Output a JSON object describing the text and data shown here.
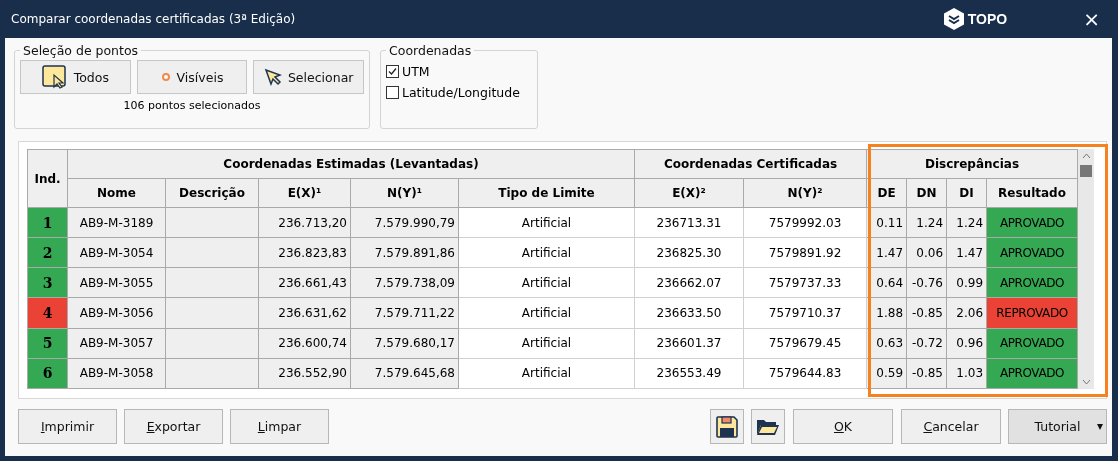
{
  "window": {
    "title": "Comparar coordenadas certificadas (3ª Edição)",
    "brand": "TOPO",
    "close": "×"
  },
  "point_selection": {
    "title": "Seleção de pontos",
    "buttons": [
      {
        "kind": "all",
        "label": "Todos"
      },
      {
        "kind": "visible",
        "label": "Visíveis"
      },
      {
        "kind": "select",
        "label": "Selecionar"
      }
    ],
    "count": "106 pontos selecionados"
  },
  "coordinates": {
    "title": "Coordenadas",
    "options": [
      {
        "label": "UTM",
        "checked": true
      },
      {
        "label": "Latitude/Longitude",
        "checked": false
      }
    ]
  },
  "table": {
    "index_header": "Ind.",
    "groups": [
      "Coordenadas Estimadas (Levantadas)",
      "Coordenadas Certificadas",
      "Discrepâncias"
    ],
    "columns": [
      "Nome",
      "Descrição",
      "E(X)¹",
      "N(Y)¹",
      "Tipo de Limite",
      "E(X)²",
      "N(Y)²",
      "DE",
      "DN",
      "DI",
      "Resultado"
    ],
    "rows": [
      {
        "index": "1",
        "color": "#34a853",
        "cells": [
          "AB9-M-3189",
          "",
          "236.713,20",
          "7.579.990,79",
          "Artificial",
          "236713.31",
          "7579992.03",
          "0.11",
          "1.24",
          "1.24",
          "APROVADO"
        ]
      },
      {
        "index": "2",
        "color": "#34a853",
        "cells": [
          "AB9-M-3054",
          "",
          "236.823,83",
          "7.579.891,86",
          "Artificial",
          "236825.30",
          "7579891.92",
          "1.47",
          "0.06",
          "1.47",
          "APROVADO"
        ]
      },
      {
        "index": "3",
        "color": "#34a853",
        "cells": [
          "AB9-M-3055",
          "",
          "236.661,43",
          "7.579.738,09",
          "Artificial",
          "236662.07",
          "7579737.33",
          "0.64",
          "-0.76",
          "0.99",
          "APROVADO"
        ]
      },
      {
        "index": "4",
        "color": "#ea4335",
        "cells": [
          "AB9-M-3056",
          "",
          "236.631,62",
          "7.579.711,22",
          "Artificial",
          "236633.50",
          "7579710.37",
          "1.88",
          "-0.85",
          "2.06",
          "REPROVADO"
        ]
      },
      {
        "index": "5",
        "color": "#34a853",
        "cells": [
          "AB9-M-3057",
          "",
          "236.600,74",
          "7.579.680,17",
          "Artificial",
          "236601.37",
          "7579679.45",
          "0.63",
          "-0.72",
          "0.96",
          "APROVADO"
        ]
      },
      {
        "index": "6",
        "color": "#34a853",
        "cells": [
          "AB9-M-3058",
          "",
          "236.552,90",
          "7.579.645,68",
          "Artificial",
          "236553.49",
          "7579644.83",
          "0.59",
          "-0.85",
          "1.03",
          "APROVADO"
        ]
      }
    ]
  },
  "left_buttons": [
    {
      "key": "I",
      "rest": "mprimir"
    },
    {
      "key": "E",
      "rest": "xportar"
    },
    {
      "key": "L",
      "rest": "impar"
    }
  ],
  "right_buttons": [
    {
      "key": "O",
      "rest": "K"
    },
    {
      "key": "C",
      "rest": "ancelar"
    }
  ],
  "tutorial": {
    "label": "Tutorial",
    "caret": "▾"
  }
}
